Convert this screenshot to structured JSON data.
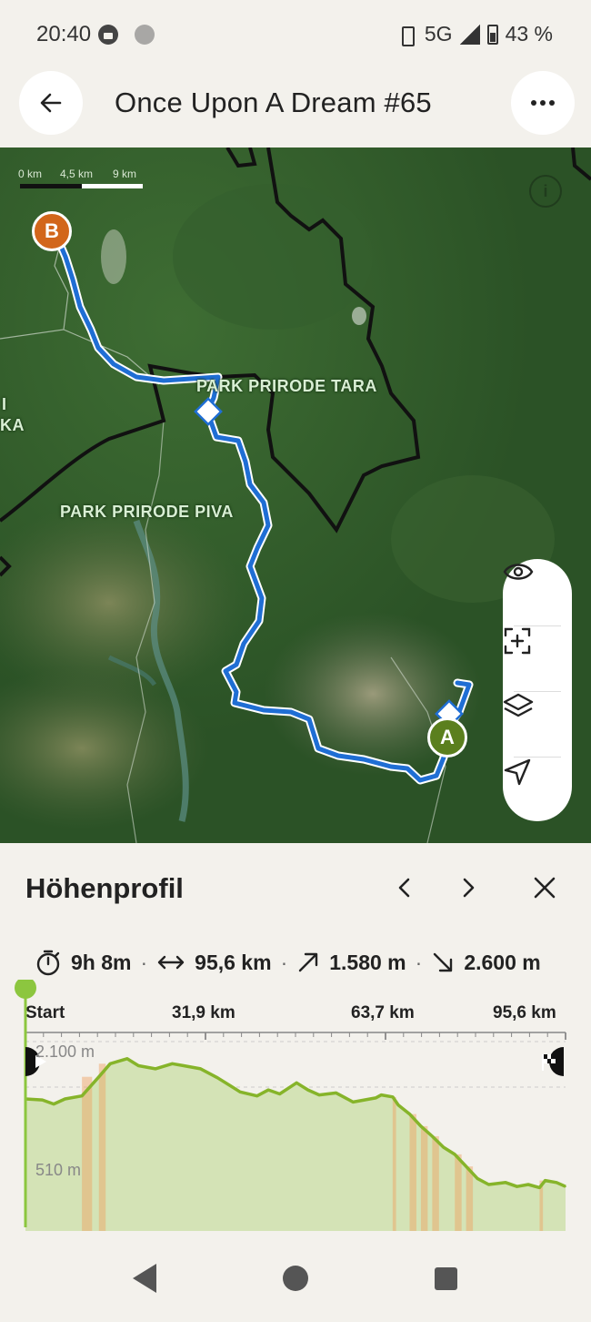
{
  "status": {
    "time": "20:40",
    "network": "5G",
    "roaming": "R",
    "battery": "43 %"
  },
  "header": {
    "title": "Once Upon A Dream #65",
    "icons": {
      "back": "arrow-left-icon",
      "more": "more-horizontal-icon"
    }
  },
  "map": {
    "scale_labels": [
      "0 km",
      "4,5 km",
      "9 km"
    ],
    "labels": {
      "park_tara": "PARK PRIRODE TARA",
      "park_piva": "PARK PRIRODE PIVA",
      "edge_left_1": "I",
      "edge_left_2": "KA"
    },
    "markers": {
      "start": "A",
      "end": "B"
    },
    "colors": {
      "route": "#1f6ed4",
      "marker_start": "#5b7f1e",
      "marker_end": "#d2661b"
    },
    "tools": [
      "eye-icon",
      "zoom-region-icon",
      "layers-icon",
      "navigate-icon"
    ]
  },
  "profile": {
    "title": "Höhenprofil",
    "stats": {
      "duration": "9h 8m",
      "distance": "95,6 km",
      "ascent": "1.580 m",
      "descent": "2.600 m"
    },
    "x_axis": [
      "Start",
      "31,9 km",
      "63,7 km",
      "95,6 km"
    ],
    "y_axis": [
      "2.100 m",
      "510 m"
    ],
    "colors": {
      "line": "#86b42a",
      "fill": "#d4e3b6",
      "steep": "#f0a060",
      "marker": "#8cc63f"
    }
  },
  "chart_data": {
    "type": "area",
    "title": "Höhenprofil",
    "xlabel": "",
    "ylabel": "",
    "x_ticks": [
      "Start",
      "31,9 km",
      "63,7 km",
      "95,6 km"
    ],
    "y_ticks": [
      "510 m",
      "2.100 m"
    ],
    "xlim": [
      0,
      95.6
    ],
    "ylim": [
      400,
      2100
    ],
    "x": [
      0,
      3,
      5,
      7,
      10,
      13,
      15,
      18,
      20,
      23,
      26,
      28,
      31,
      34,
      38,
      41,
      43,
      45,
      48,
      50,
      52,
      55,
      58,
      60,
      62,
      63,
      65,
      66,
      68,
      70,
      72,
      74,
      76,
      78,
      80,
      82,
      85,
      87,
      89,
      91,
      92,
      94,
      95.6
    ],
    "y": [
      1530,
      1520,
      1480,
      1530,
      1560,
      1750,
      1880,
      1930,
      1860,
      1830,
      1880,
      1860,
      1830,
      1740,
      1600,
      1560,
      1620,
      1580,
      1690,
      1620,
      1570,
      1590,
      1500,
      1520,
      1540,
      1570,
      1550,
      1470,
      1380,
      1260,
      1160,
      1050,
      980,
      860,
      740,
      680,
      700,
      660,
      680,
      650,
      720,
      700,
      660
    ]
  },
  "system_nav": [
    "back-icon",
    "home-icon",
    "recents-icon"
  ]
}
